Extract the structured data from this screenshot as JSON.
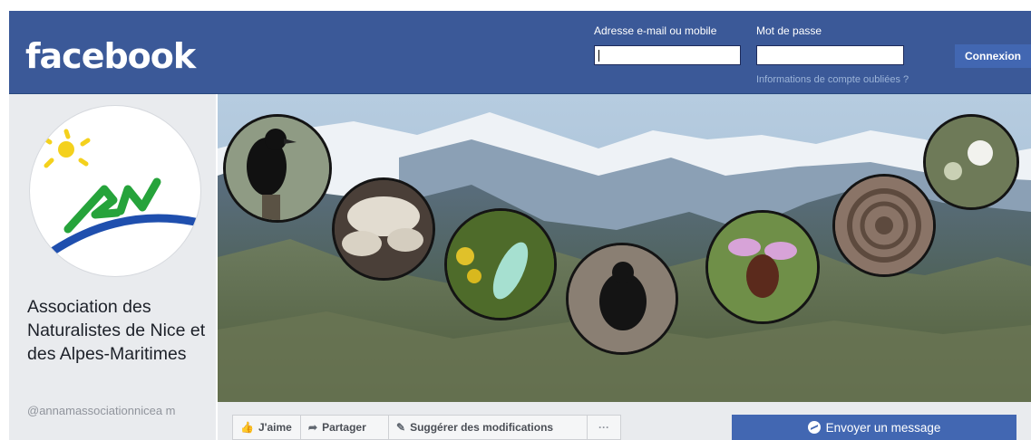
{
  "header": {
    "logo": "facebook",
    "email_label": "Adresse e-mail ou mobile",
    "password_label": "Mot de passe",
    "email_value": "",
    "password_value": "",
    "login_button": "Connexion",
    "forgot_link": "Informations de compte oubliées ?"
  },
  "page": {
    "name": "Association des Naturalistes de Nice et des Alpes-Maritimes",
    "handle": "@annamassociationnicea m"
  },
  "cover": {
    "photos": [
      "raven-photo",
      "mushroom-photo",
      "moth-photo",
      "beetle-photo",
      "orchid-photo",
      "ammonite-photo",
      "lichen-photo"
    ]
  },
  "actions": {
    "like": "J'aime",
    "share": "Partager",
    "suggest": "Suggérer des modifications",
    "more": "···",
    "message": "Envoyer un message"
  },
  "colors": {
    "brand_blue": "#3b5998",
    "button_blue": "#4267b2",
    "page_bg": "#e9ebee"
  }
}
